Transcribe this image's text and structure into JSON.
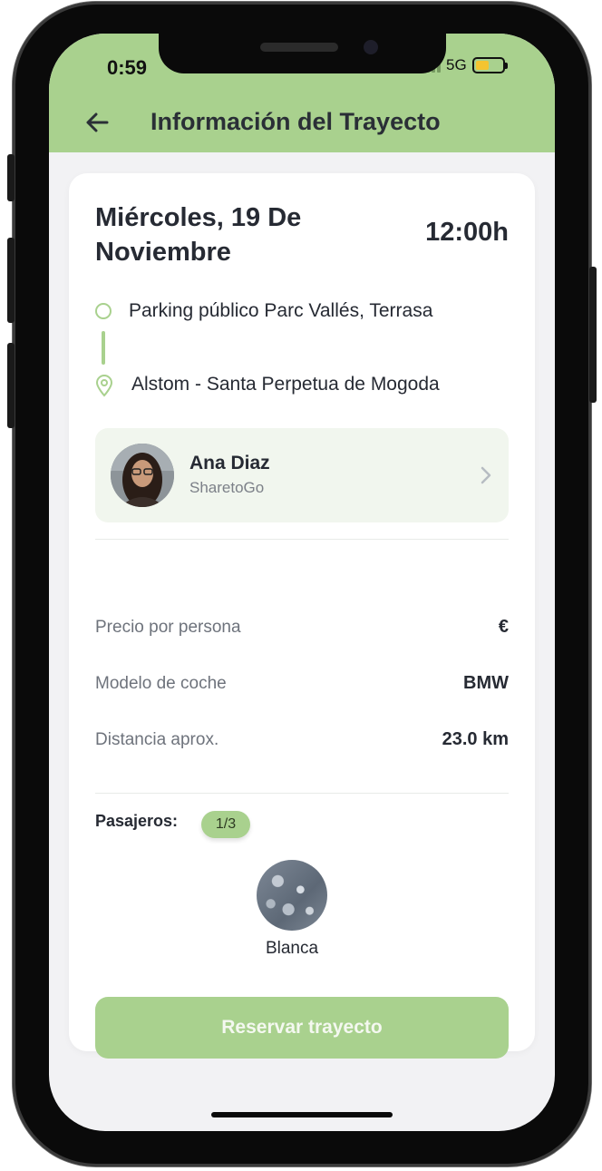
{
  "status_bar": {
    "time": "0:59",
    "network": "5G"
  },
  "header": {
    "title": "Información del Trayecto",
    "back_icon": "arrow-left-icon"
  },
  "trip": {
    "date": "Miércoles, 19 De Noviembre",
    "time": "12:00h",
    "origin": "Parking público Parc Vallés, Terrasa",
    "destination": "Alstom - Santa Perpetua de Mogoda"
  },
  "driver": {
    "name": "Ana Diaz",
    "company": "SharetoGo"
  },
  "details": {
    "price_label": "Precio por persona",
    "price_value": "€",
    "car_label": "Modelo de coche",
    "car_value": "BMW",
    "distance_label": "Distancia aprox.",
    "distance_value": "23.0 km"
  },
  "passengers": {
    "label": "Pasajeros:",
    "count": "1/3",
    "items": [
      {
        "name": "Blanca"
      }
    ]
  },
  "action": {
    "reserve_label": "Reservar trayecto"
  },
  "colors": {
    "accent": "#a9d18e",
    "driver_card_bg": "#f1f6ee",
    "text_dark": "#262a33"
  }
}
